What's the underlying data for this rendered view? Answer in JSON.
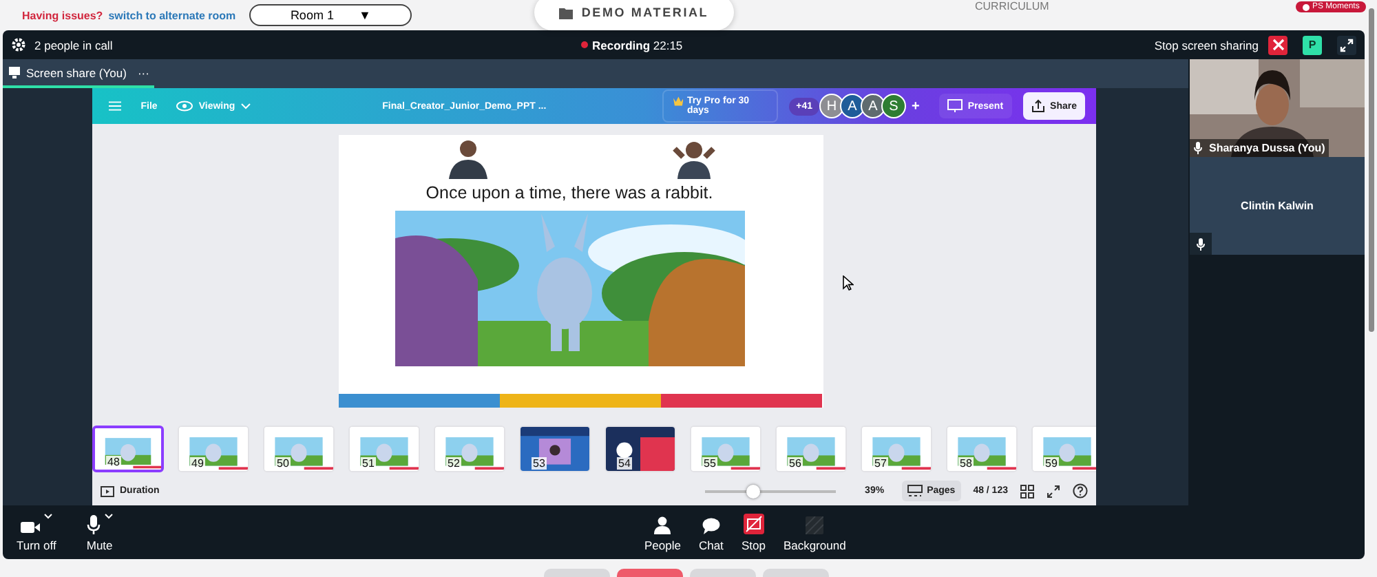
{
  "top_bar": {
    "issue_text": "Having issues?",
    "alternate_link": "switch to alternate room",
    "room_select": "Room 1",
    "room_caret": "▼",
    "demo_button": "DEMO MATERIAL",
    "curriculum": "CURRICULUM",
    "moments_badge": "PS Moments"
  },
  "call_header": {
    "people": "2 people in call",
    "recording_label": "Recording",
    "recording_time": "22:15",
    "stop_sharing": "Stop screen sharing",
    "avatar": "P"
  },
  "share_tab": {
    "label": "Screen share (You)",
    "more": "···"
  },
  "canva": {
    "menu": "File",
    "mode": "Viewing",
    "doc_title": "Final_Creator_Junior_Demo_PPT ...",
    "try_pro": "Try Pro for 30 days",
    "collab_count": "+41",
    "collaborators": [
      {
        "initial": "H",
        "color": "#8e8e93"
      },
      {
        "initial": "A",
        "color": "#1f5c99"
      },
      {
        "initial": "A",
        "color": "#5f6b6f"
      },
      {
        "initial": "S",
        "color": "#2e7d32"
      }
    ],
    "add": "+",
    "present": "Present",
    "share": "Share",
    "slide": {
      "caption": "Once upon a time, there was a rabbit."
    },
    "thumbnails": [
      {
        "page": "48",
        "selected": true,
        "kind": "scene"
      },
      {
        "page": "49",
        "selected": false,
        "kind": "scene"
      },
      {
        "page": "50",
        "selected": false,
        "kind": "scene"
      },
      {
        "page": "51",
        "selected": false,
        "kind": "scene"
      },
      {
        "page": "52",
        "selected": false,
        "kind": "scene"
      },
      {
        "page": "53",
        "selected": false,
        "kind": "blue"
      },
      {
        "page": "54",
        "selected": false,
        "kind": "split"
      },
      {
        "page": "55",
        "selected": false,
        "kind": "scene"
      },
      {
        "page": "56",
        "selected": false,
        "kind": "scene"
      },
      {
        "page": "57",
        "selected": false,
        "kind": "scene"
      },
      {
        "page": "58",
        "selected": false,
        "kind": "scene"
      },
      {
        "page": "59",
        "selected": false,
        "kind": "scene"
      }
    ],
    "footer": {
      "duration": "Duration",
      "level": 0.37,
      "zoom": "39%",
      "pages": "Pages",
      "page_count": "48 / 123"
    }
  },
  "participants": [
    {
      "name": "Sharanya Dussa (You)",
      "kind": "video"
    },
    {
      "name": "Clintin Kalwin",
      "kind": "tile"
    }
  ],
  "controls": [
    {
      "label": "Turn off",
      "kind": "camera",
      "caret": true
    },
    {
      "label": "Mute",
      "kind": "mic",
      "caret": true
    },
    {
      "label": "People",
      "kind": "people",
      "caret": false
    },
    {
      "label": "Chat",
      "kind": "chat",
      "caret": false
    },
    {
      "label": "Stop",
      "kind": "stop",
      "caret": false
    },
    {
      "label": "Background",
      "kind": "background",
      "caret": false
    }
  ],
  "bottom_tabs": [
    {
      "color": "#d9d9dc"
    },
    {
      "color": "#ee5a6a"
    },
    {
      "color": "#d9d9dc"
    },
    {
      "color": "#d9d9dc"
    }
  ]
}
